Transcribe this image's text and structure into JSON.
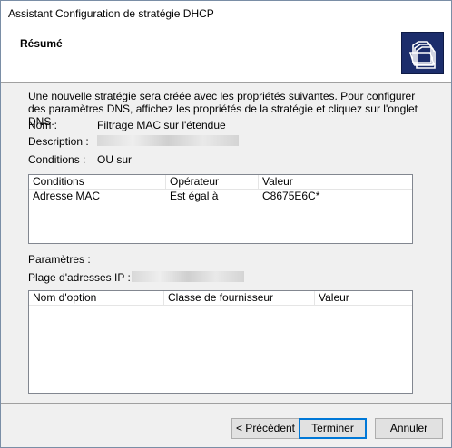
{
  "window": {
    "title": "Assistant Configuration de stratégie DHCP"
  },
  "header": {
    "title": "Résumé",
    "icon": "folders-icon"
  },
  "intro": "Une nouvelle stratégie sera créée avec les propriétés suivantes. Pour configurer des paramètres DNS, affichez les propriétés de la stratégie et cliquez sur l'onglet DNS.",
  "fields": {
    "name_label": "Nom :",
    "name_value": "Filtrage MAC sur l'étendue",
    "description_label": "Description :",
    "conditions_label": "Conditions :",
    "conditions_value": "OU sur"
  },
  "conditions_table": {
    "headers": [
      "Conditions",
      "Opérateur",
      "Valeur"
    ],
    "rows": [
      [
        "Adresse MAC",
        "Est égal à",
        "C8675E6C*"
      ]
    ]
  },
  "parameters_label": "Paramètres :",
  "ip_range_label": "Plage d'adresses IP :",
  "options_table": {
    "headers": [
      "Nom d'option",
      "Classe de fournisseur",
      "Valeur"
    ],
    "rows": []
  },
  "buttons": {
    "back": "< Précédent",
    "finish": "Terminer",
    "cancel": "Annuler"
  }
}
